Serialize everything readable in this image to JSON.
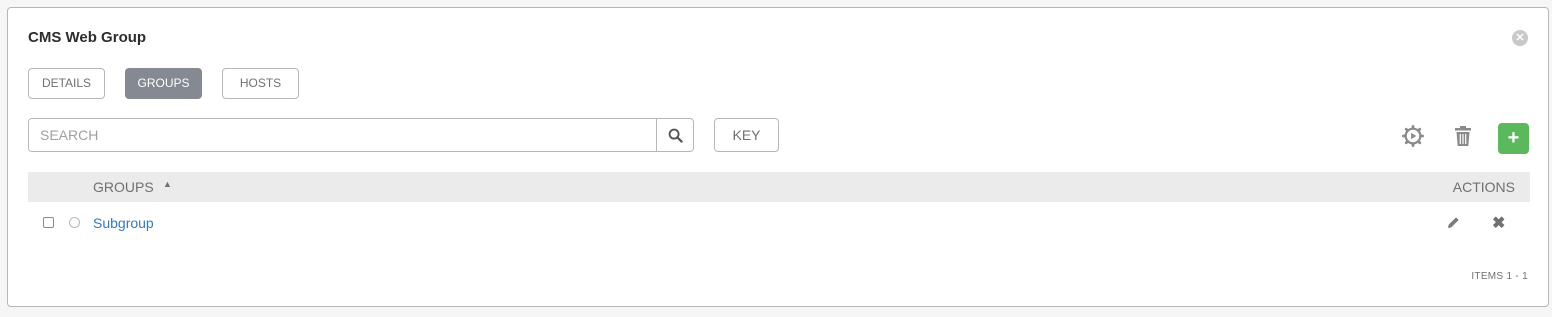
{
  "panel": {
    "title": "CMS Web Group",
    "close_icon": "close-circle-icon"
  },
  "tabs": [
    {
      "label": "DETAILS",
      "active": false
    },
    {
      "label": "GROUPS",
      "active": true
    },
    {
      "label": "HOSTS",
      "active": false
    }
  ],
  "toolbar": {
    "search_placeholder": "SEARCH",
    "search_icon": "search-icon",
    "key_label": "KEY",
    "sync_icon": "sync-gear-icon",
    "trash_icon": "trash-icon",
    "add_label": "+",
    "add_color": "#5cb85c"
  },
  "table": {
    "columns": {
      "groups": "GROUPS",
      "actions": "ACTIONS"
    },
    "sort_indicator": "▲",
    "rows": [
      {
        "name": "Subgroup",
        "edit_icon": "pencil-icon",
        "delete_icon": "close-icon",
        "delete_glyph": "✖"
      }
    ]
  },
  "pagination": {
    "text": "ITEMS  1 - 1"
  },
  "colors": {
    "active_tab": "#848992",
    "link": "#337ab7",
    "header_bg": "#ebebeb"
  }
}
